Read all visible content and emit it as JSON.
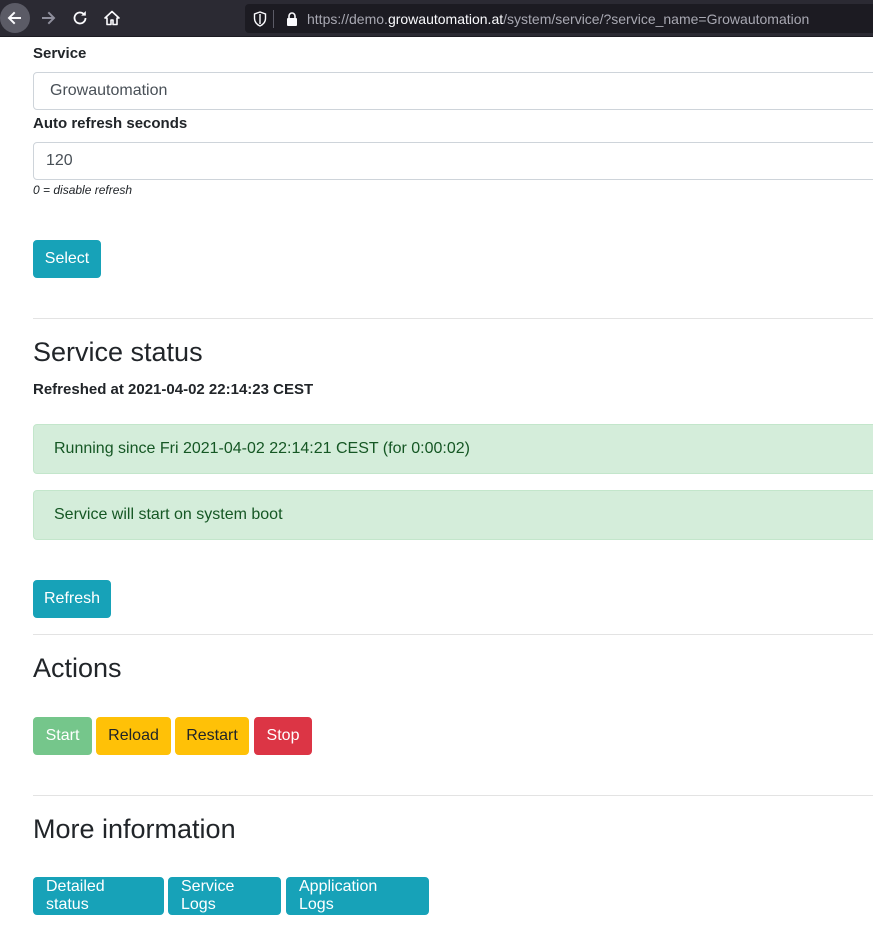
{
  "browser": {
    "url_prefix": "https://demo.",
    "url_host": "growautomation.at",
    "url_path": "/system/service/?service_name=Growautomation",
    "icons": [
      "back-arrow-icon",
      "forward-arrow-icon",
      "reload-icon",
      "home-icon",
      "shield-icon",
      "lock-icon"
    ]
  },
  "form": {
    "service_label": "Service",
    "service_value": "Growautomation",
    "refresh_label": "Auto refresh seconds",
    "refresh_value": "120",
    "refresh_help": "0 = disable refresh",
    "select_button": "Select"
  },
  "status": {
    "heading": "Service status",
    "refreshed": "Refreshed at 2021-04-02 22:14:23 CEST",
    "running": "Running since Fri 2021-04-02 22:14:21 CEST (for 0:00:02)",
    "boot": "Service will start on system boot",
    "refresh_button": "Refresh"
  },
  "actions": {
    "heading": "Actions",
    "start": "Start",
    "reload": "Reload",
    "restart": "Restart",
    "stop": "Stop"
  },
  "info": {
    "heading": "More information",
    "detailed_status": "Detailed status",
    "service_logs": "Service Logs",
    "application_logs": "Application Logs"
  },
  "colors": {
    "info": "#17a2b8",
    "success": "#75c68b",
    "warning": "#ffc107",
    "danger": "#dc3545",
    "alert_bg": "#d4edda",
    "alert_text": "#155724"
  }
}
